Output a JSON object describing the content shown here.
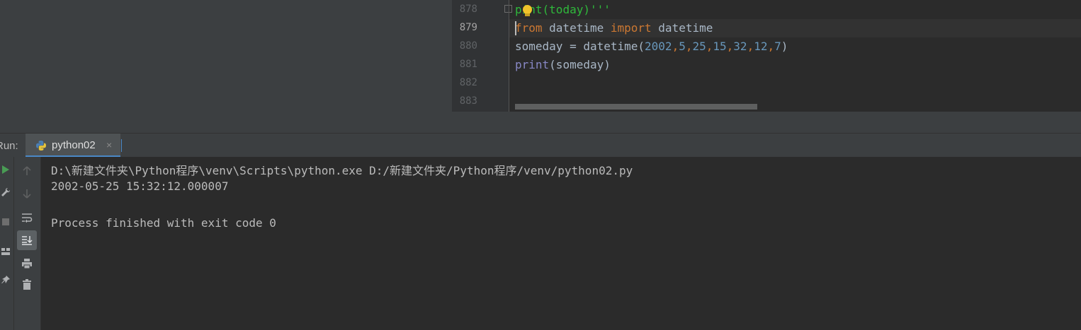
{
  "editor": {
    "lines": [
      {
        "number": "878",
        "text": "print(today)'''"
      },
      {
        "number": "879",
        "text": "from datetime import datetime",
        "active": true
      },
      {
        "number": "880",
        "text": "someday = datetime(2002,5,25,15,32,12,7)"
      },
      {
        "number": "881",
        "text": "print(someday)"
      },
      {
        "number": "882",
        "text": ""
      },
      {
        "number": "883",
        "text": ""
      }
    ],
    "tokens": {
      "l878_a": "p",
      "l878_b": "int(today)'''",
      "l879_kw1": "from",
      "l879_mod": " datetime ",
      "l879_kw2": "import",
      "l879_name": " datetime",
      "l880_a": "someday = datetime(",
      "l880_n1": "2002",
      "l880_n2": "5",
      "l880_n3": "25",
      "l880_n4": "15",
      "l880_n5": "32",
      "l880_n6": "12",
      "l880_n7": "7",
      "l880_close": ")",
      "comma": ",",
      "l881_fn": "print",
      "l881_rest": "(someday)"
    },
    "colors": {
      "keyword": "#cc7832",
      "number": "#6897bb",
      "builtin": "#8888c6",
      "docstring": "#2fb93b",
      "text": "#a9b7c6"
    }
  },
  "run_panel": {
    "label": "Run:",
    "tab_label": "python02",
    "tab_close": "×",
    "tab_icon": "python-icon",
    "accent": "#4a88c7"
  },
  "toolbar_left": [
    "run-icon",
    "wrench-icon",
    "stop-icon",
    "layout-icon",
    "pin-icon"
  ],
  "toolbar_right": [
    "arrow-up-icon",
    "arrow-down-icon",
    "soft-wrap-icon",
    "scroll-to-end-icon",
    "print-icon",
    "trash-icon"
  ],
  "console": {
    "lines": [
      "D:\\新建文件夹\\Python程序\\venv\\Scripts\\python.exe D:/新建文件夹/Python程序/venv/python02.py",
      "2002-05-25 15:32:12.000007",
      "",
      "Process finished with exit code 0"
    ]
  }
}
